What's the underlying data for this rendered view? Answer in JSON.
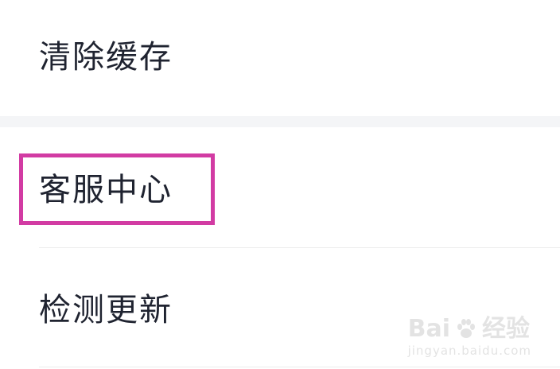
{
  "settings_menu": {
    "items": [
      {
        "label": "清除缓存"
      },
      {
        "label": "客服中心"
      },
      {
        "label": "检测更新"
      }
    ]
  },
  "annotation": {
    "highlight_color": "#d23ba3",
    "highlighted_item": "客服中心"
  },
  "watermark": {
    "logo_text_left": "Bai",
    "logo_text_right": "经验",
    "url": "jingyan.baidu.com"
  },
  "colors": {
    "text": "#1f2330",
    "background": "#ffffff",
    "section_gap": "#f4f5f7",
    "divider": "#ececec"
  }
}
